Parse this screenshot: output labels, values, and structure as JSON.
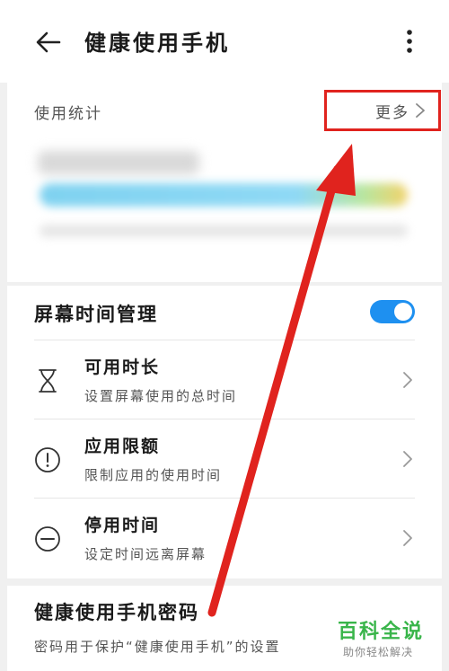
{
  "header": {
    "title": "健康使用手机",
    "back_icon": "arrow-left-icon",
    "menu_icon": "more-vertical-icon"
  },
  "usage_stats": {
    "title": "使用统计",
    "more_label": "更多"
  },
  "screen_time": {
    "title": "屏幕时间管理",
    "toggle_on": true,
    "accent_color": "#1e90f0",
    "items": [
      {
        "icon": "hourglass-icon",
        "title": "可用时长",
        "subtitle": "设置屏幕使用的总时间"
      },
      {
        "icon": "alert-circle-icon",
        "title": "应用限额",
        "subtitle": "限制应用的使用时间"
      },
      {
        "icon": "minus-circle-icon",
        "title": "停用时间",
        "subtitle": "设定时间远离屏幕"
      }
    ]
  },
  "password": {
    "title": "健康使用手机密码",
    "description": "密码用于保护“健康使用手机”的设置"
  },
  "watermark": {
    "main": "百科全说",
    "sub": "助你轻松解决"
  },
  "annotation_color": "#e0231e"
}
